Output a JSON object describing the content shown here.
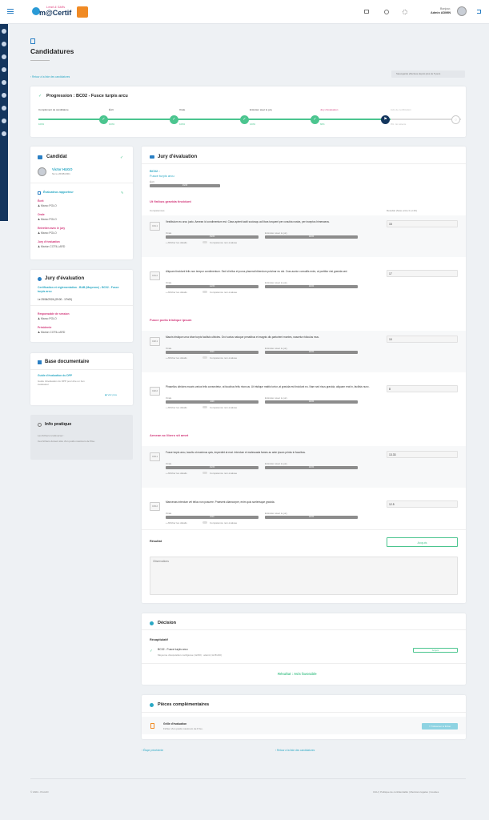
{
  "topbar": {
    "logo_text": "m@Certif",
    "logo_tagline": "Lead & Skills",
    "greeting": "Bonjour,",
    "user_name": "Admin ADMIN"
  },
  "page": {
    "title": "Candidatures",
    "back_link": "Retour à la liste des candidatures",
    "save_hint": "Sauvegarde effectuée depuis plus de 5 jours"
  },
  "progress": {
    "title": "Progression : BC02 - Fusce turpis arcu",
    "steps": [
      {
        "label": "Complément de candidature",
        "pct": "100%",
        "state": "done"
      },
      {
        "label": "Écrit",
        "pct": "100%",
        "state": "done"
      },
      {
        "label": "Orale",
        "pct": "100%",
        "state": "done"
      },
      {
        "label": "Entretien avec le jury",
        "pct": "100%",
        "state": "done"
      },
      {
        "label": "Jury d'évaluation",
        "pct": "66%",
        "state": "current"
      },
      {
        "label": "Avis de certification",
        "pct": "0% - En attente",
        "state": "todo"
      }
    ]
  },
  "candidat": {
    "title": "Candidat",
    "name": "Victor HUGO",
    "dob": "Né le 26/08/2001",
    "evaluateur_title": "Évaluateur-rapporteur",
    "sections": [
      {
        "label": "Écrit",
        "person": "Marco POLO"
      },
      {
        "label": "Orale",
        "person": "Marco POLO"
      },
      {
        "label": "Entretien avec le jury",
        "person": "Marco POLO"
      },
      {
        "label": "Jury d'évaluation",
        "person": "Marion COTILLARD"
      }
    ]
  },
  "jury_side": {
    "title": "Jury d'évaluation",
    "link": "Certification et réglementation - BAB (Mayenne) - BC02 - Fusce turpis arcu",
    "date": "Le 25/04/2024 (09:00 - 17h00)",
    "responsable_label": "Responsable de session",
    "responsable": "Marco POLO",
    "presidente_label": "Présidente",
    "presidente": "Marion COTILLARD"
  },
  "base_doc": {
    "title": "Base documentaire",
    "doc_title": "Guide d'évaluation du DPP",
    "doc_desc": "Guide d'évaluation du DPP pour être un bon évaluateur",
    "more": "Voir plus"
  },
  "info": {
    "title": "Info pratique",
    "line1": "Les fichiers à téléverser :",
    "line2": "Ces fichiers doivent être d'un poids maximum de 5Go."
  },
  "jury": {
    "title": "Jury d'évaluation",
    "bc_code": "BC02 :",
    "bc_name": "Fusce turpis arcu",
    "ecrit_label": "Écrit",
    "ecrit_value": "16/20",
    "col_comp": "Compétences",
    "col_result": "Résultat (Note entre 0 et 20)",
    "orale_label": "Orale",
    "entretien_label": "Entretien avec le jury",
    "details_label": "Afficher les détails",
    "toggle_label": "Compétence non évaluée",
    "groups": [
      {
        "title": "Ut finibus gravida tincidunt",
        "items": [
          {
            "code": "C01.1",
            "text": "Vestibulum eu arcu justo. Aenean id condimentum est. Class aptent taciti sociosqu ad litora torquent per conubia nostra, per inceptos himenaeos.",
            "orale": "15/20",
            "entretien": "18/20",
            "result": "15"
          },
          {
            "code": "C01.2",
            "text": "Aliquam tincidunt felis non tempor condimentum. Sed id tellus et purus placerat bibendum pulvinar eu dui. Cras auctor convallis enim, at porttitor nisi gravida sed.",
            "orale": "12/20",
            "entretien": "18/20",
            "result": "17"
          }
        ]
      },
      {
        "title": "Fusce porta tristique ipsum",
        "items": [
          {
            "code": "C02.1",
            "text": "Mauris tristique urna vitae turpis facilisis ultricies. Orci varius natoque penatibus et magnis dis parturient montes, nascetur ridiculus mus.",
            "orale": "8/20",
            "entretien": "18/20",
            "result": "10"
          },
          {
            "code": "C02.2",
            "text": "Phasellus ultricies mauris varius felis consectetur, at faucibus felis rhoncus. Ut tristique mattis tortor, at gravida est tincidunt eu. Nam sed risus gravida, aliquam erat in, facilisis nunc.",
            "orale": "4/20",
            "entretien": "18/20",
            "result": "8"
          }
        ]
      },
      {
        "title": "Aenean ac libero sit amet",
        "items": [
          {
            "code": "C03.1",
            "text": "Fusce turpis arcu, iaculis ut maximus quis, imperdiet at erat. Interdum et malesuada fames ac ante ipsum primis in faucibus.",
            "orale": "16/20",
            "entretien": "18/20",
            "result": "13.33"
          },
          {
            "code": "C03.2",
            "text": "Maecenas interdum vel tellus non posuere. Praesent ullamcorper, enim quis scelerisque gravida.",
            "orale": "8/20",
            "entretien": "18/20",
            "result": "12.5"
          }
        ]
      }
    ],
    "resultat_label": "Résultat",
    "resultat_value": "Acquis",
    "observations_placeholder": "Observations"
  },
  "decision": {
    "title": "Décision",
    "recap_label": "Récapitulatif",
    "item_title": "BC02 - Fusce turpis arcu",
    "item_desc": "Moyenne d'acquisition configurée (12/20) : atteint (12.81/20)",
    "item_badge": "Acquis",
    "final": "Résultat : Avis favorable"
  },
  "pieces": {
    "title": "Pièces complémentaires",
    "item_title": "Grille d'évaluation",
    "item_desc": "Fichier d'un poids maximum de 8 Go.",
    "upload_label": "Téléverser le fichier"
  },
  "nav": {
    "prev": "Étape précédente",
    "back": "Retour à la liste des candidatures"
  },
  "footer": {
    "copyright": "© 2024 - Proti-ID",
    "links": "CGU | Politique de confidentialité | Mentions légales | Cookies"
  }
}
